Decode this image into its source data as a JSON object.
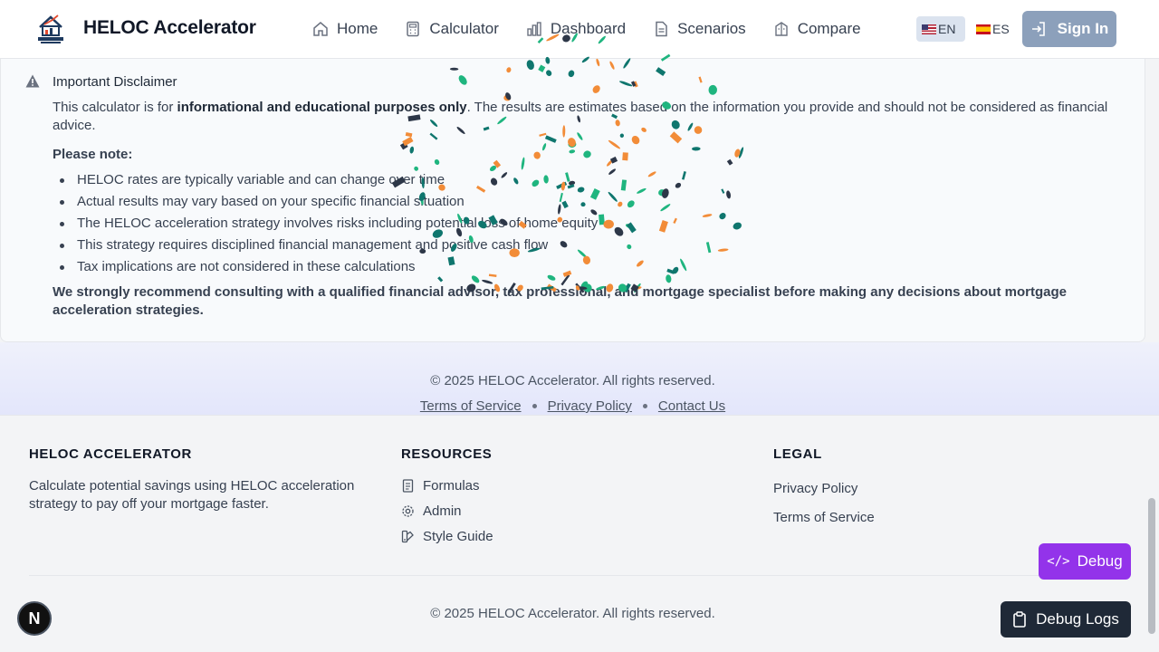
{
  "header": {
    "brand": "HELOC Accelerator",
    "nav": [
      {
        "label": "Home",
        "icon": "home-icon"
      },
      {
        "label": "Calculator",
        "icon": "calculator-icon"
      },
      {
        "label": "Dashboard",
        "icon": "bar-chart-icon"
      },
      {
        "label": "Scenarios",
        "icon": "file-icon"
      },
      {
        "label": "Compare",
        "icon": "scale-icon"
      }
    ],
    "lang_en": "EN",
    "lang_es": "ES",
    "sign_in": "Sign In"
  },
  "disclaimer": {
    "title": "Important Disclaimer",
    "intro_prefix": "This calculator is for ",
    "intro_bold": "informational and educational purposes only",
    "intro_suffix": ". The results are estimates based on the information you provide and should not be considered as financial advice.",
    "note_label": "Please note:",
    "items": [
      "HELOC rates are typically variable and can change over time",
      "Actual results may vary based on your specific financial situation",
      "The HELOC acceleration strategy involves risks including potential loss of home equity",
      "This strategy requires disciplined financial management and positive cash flow",
      "Tax implications are not considered in these calculations"
    ],
    "recommendation": "We strongly recommend consulting with a qualified financial advisor, tax professional, and mortgage specialist before making any decisions about mortgage acceleration strategies."
  },
  "footer_band": {
    "copyright": "© 2025 HELOC Accelerator. All rights reserved.",
    "links": [
      "Terms of Service",
      "Privacy Policy",
      "Contact Us"
    ]
  },
  "footer": {
    "about_heading": "HELOC ACCELERATOR",
    "about_text": "Calculate potential savings using HELOC acceleration strategy to pay off your mortgage faster.",
    "resources_heading": "RESOURCES",
    "resources": [
      {
        "label": "Formulas",
        "icon": "document-icon"
      },
      {
        "label": "Admin",
        "icon": "gear-icon"
      },
      {
        "label": "Style Guide",
        "icon": "palette-icon"
      }
    ],
    "legal_heading": "LEGAL",
    "legal": [
      "Privacy Policy",
      "Terms of Service"
    ],
    "copyright": "© 2025 HELOC Accelerator. All rights reserved."
  },
  "floating": {
    "next_badge": "N",
    "debug": "Debug",
    "debug_logs": "Debug Logs"
  },
  "colors": {
    "confetti": [
      "#f28c38",
      "#1fb57f",
      "#2d3748",
      "#0f766e"
    ],
    "sign_in_bg": "#8ca0bb",
    "debug_bg": "#9333ea",
    "debug_logs_bg": "#1f2937"
  }
}
